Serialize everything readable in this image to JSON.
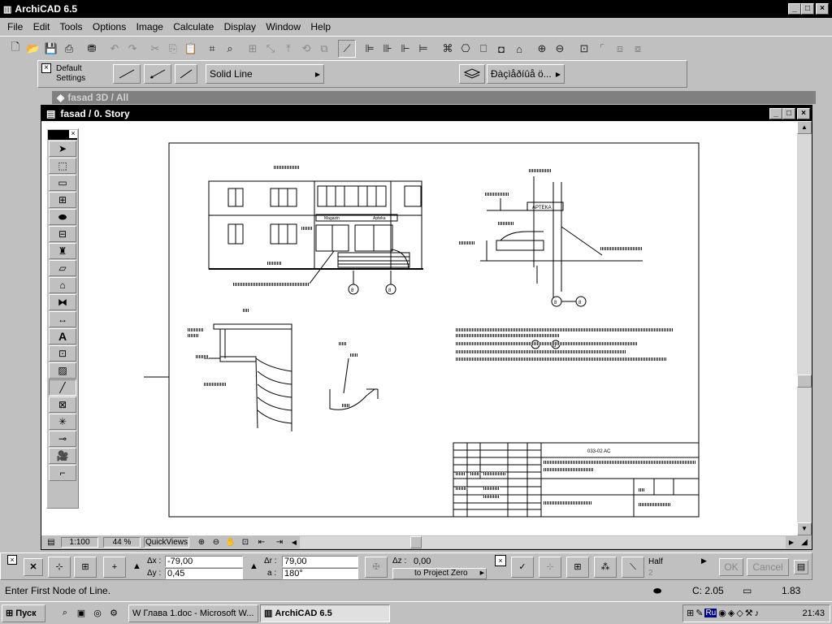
{
  "app": {
    "title": "ArchiCAD 6.5"
  },
  "menu": [
    "File",
    "Edit",
    "Tools",
    "Options",
    "Image",
    "Calculate",
    "Display",
    "Window",
    "Help"
  ],
  "infobox": {
    "default_settings_line1": "Default",
    "default_settings_line2": "Settings",
    "line_type": "Solid Line",
    "layer": "Đàçìåðíûå ö..."
  },
  "bg_window": {
    "title": "fasad 3D / All"
  },
  "doc_window": {
    "title": "fasad / 0. Story"
  },
  "drawing": {
    "title_block_code": "033-02   AC",
    "sign_left": "Magazin",
    "sign_right": "Apteka",
    "section_sign": "APTEKA",
    "axis_labels": [
      "8",
      "8",
      "8",
      "8",
      "8"
    ]
  },
  "doc_status": {
    "scale": "1:100",
    "zoom": "44 %",
    "quickviews": "QuickViews"
  },
  "coord": {
    "dx_label": "Δx :",
    "dx": "-79,00",
    "dy_label": "Δy :",
    "dy": "0,45",
    "dr_label": "Δr :",
    "dr": "79,00",
    "a_label": "a :",
    "a": "180°",
    "dz_label": "Δz :",
    "dz": "0,00",
    "project_zero": "to Project Zero",
    "half": "Half",
    "half_val": "2",
    "ok": "OK",
    "cancel": "Cancel"
  },
  "status": {
    "message": "Enter First Node of Line.",
    "disk": "C: 2.05",
    "memory": "1.83"
  },
  "taskbar": {
    "start": "Пуск",
    "word_task": "Глава 1.doc - Microsoft W...",
    "archicad_task": "ArchiCAD 6.5",
    "lang": "Ru",
    "clock": "21:43"
  }
}
